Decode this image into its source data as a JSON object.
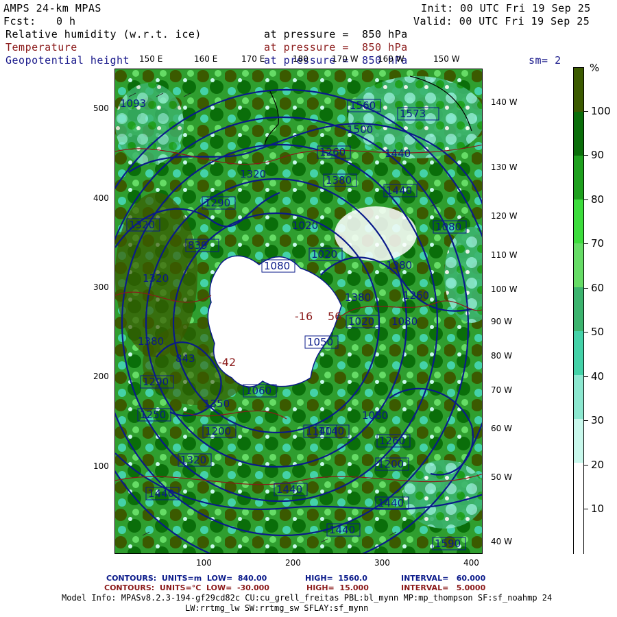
{
  "header": {
    "model": "AMPS 24-km MPAS",
    "fcst_label": "Fcst:",
    "fcst_value": "0 h",
    "init": "Init: 00 UTC Fri 19 Sep 25",
    "valid": "Valid: 00 UTC Fri 19 Sep 25",
    "fields": [
      {
        "name": "Relative humidity (w.r.t. ice)",
        "level": "at pressure =  850 hPa",
        "color": "#000000"
      },
      {
        "name": "Temperature",
        "level": "at pressure =  850 hPa",
        "color": "#8b1a1a"
      },
      {
        "name": "Geopotential height",
        "level": "at pressure =  850 hPa",
        "color": "#1a1a8b"
      }
    ],
    "smoothing": "sm= 2"
  },
  "map": {
    "top_lon_labels": [
      "150 E",
      "160 E",
      "170 E",
      "180",
      "170 W",
      "160 W",
      "150 W"
    ],
    "right_lon_labels": [
      "140 W",
      "130 W",
      "120 W",
      "110 W",
      "100 W",
      "90 W",
      "80 W",
      "70 W",
      "60 W",
      "50 W",
      "40 W"
    ],
    "left_y_ticks": [
      "500",
      "400",
      "300",
      "200",
      "100"
    ],
    "bottom_x_ticks": [
      "100",
      "200",
      "300",
      "400"
    ],
    "height_labels": [
      "1093",
      "1573",
      "1560",
      "1500",
      "1260",
      "1440",
      "1320",
      "1380",
      "1440",
      "1290",
      "1320",
      "1020",
      "1080",
      "1080",
      "1020",
      "1320",
      "1380",
      "1260",
      "1050",
      "1080",
      "1020",
      "1380",
      "1290",
      "1350",
      "1140",
      "1200",
      "1250",
      "1260",
      "1440",
      "1440",
      "1440",
      "1320",
      "1200",
      "1440",
      "1590",
      "839",
      "843",
      "1380",
      "1060",
      "1080",
      "1140"
    ],
    "temp_labels": [
      "-16",
      "56",
      "-42"
    ],
    "colors": {
      "height_contour": "#0a1a8a",
      "temp_contour": "#8b1a1a",
      "land": "#ffffff"
    }
  },
  "colorbar": {
    "unit": "%",
    "labels": [
      "100",
      "90",
      "80",
      "70",
      "60",
      "50",
      "40",
      "30",
      "20",
      "10"
    ],
    "colors": [
      "#3b5a00",
      "#0a6e0a",
      "#1ea01e",
      "#3cc83c",
      "#66dc66",
      "#3cb46e",
      "#44d2a8",
      "#8ce8d0",
      "#c8f8ec",
      "#ffffff",
      "#ffffff"
    ]
  },
  "footer": {
    "line1_left": "CONTOURS:  UNITS=m  LOW=  840.00",
    "line1_high": "HIGH=  1560.0",
    "line1_int": "INTERVAL=   60.000",
    "line2_left": "CONTOURS:  UNITS=°C  LOW=  -30.000",
    "line2_high": "HIGH=  15.000",
    "line2_int": "INTERVAL=   5.0000",
    "model_info": "Model Info: MPASv8.2.3-194-gf29cd82c CU:cu_grell_freitas PBL:bl_mynn MP:mp_thompson SF:sf_noahmp 24",
    "model_info2": "LW:rrtmg_lw SW:rrtmg_sw SFLAY:sf_mynn"
  }
}
